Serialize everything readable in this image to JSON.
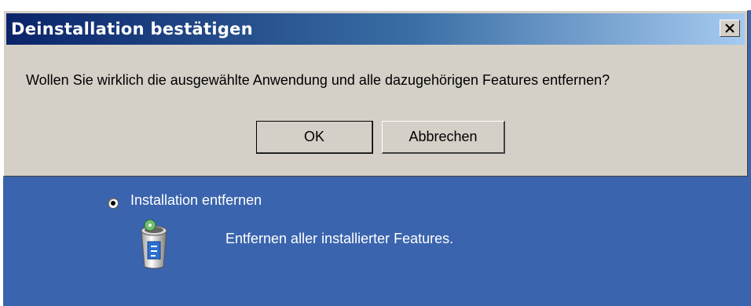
{
  "dialog": {
    "title": "Deinstallation bestätigen",
    "close_label": "×",
    "message": "Wollen Sie wirklich die ausgewählte Anwendung und alle dazugehörigen Features entfernen?",
    "ok_label": "OK",
    "cancel_label": "Abbrechen"
  },
  "background": {
    "radio_label": "Installation entfernen",
    "radio_selected": true,
    "description": "Entfernen aller installierter Features.",
    "icon": "recycle-bin-icon"
  },
  "colors": {
    "background_blue": "#3a64ad",
    "dialog_face": "#d4d0c8",
    "titlebar_start": "#0a246a",
    "titlebar_end": "#a6caf0"
  }
}
